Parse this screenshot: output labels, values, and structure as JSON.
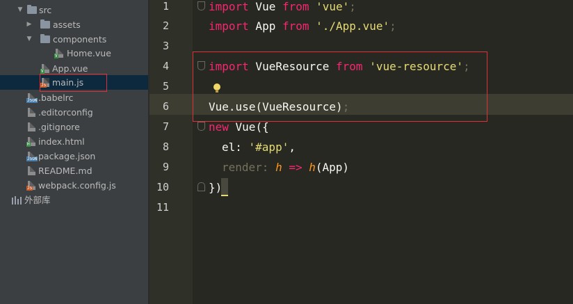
{
  "project_tree": {
    "items": [
      {
        "label": "src",
        "kind": "folder",
        "expanded": true
      },
      {
        "label": "assets",
        "kind": "folder",
        "expanded": false
      },
      {
        "label": "components",
        "kind": "folder",
        "expanded": true
      },
      {
        "label": "Home.vue",
        "kind": "vue-file",
        "badge": "V"
      },
      {
        "label": "App.vue",
        "kind": "vue-file",
        "badge": "V"
      },
      {
        "label": "main.js",
        "kind": "js-file",
        "badge": "JS",
        "selected": true
      },
      {
        "label": ".babelrc",
        "kind": "json-file",
        "badge": "JSON"
      },
      {
        "label": ".editorconfig",
        "kind": "text-file"
      },
      {
        "label": ".gitignore",
        "kind": "text-file"
      },
      {
        "label": "index.html",
        "kind": "html-file",
        "badge": "H"
      },
      {
        "label": "package.json",
        "kind": "json-file",
        "badge": "JSON"
      },
      {
        "label": "README.md",
        "kind": "text-file"
      },
      {
        "label": "webpack.config.js",
        "kind": "js-file",
        "badge": "JS"
      },
      {
        "label": "外部库",
        "kind": "external-libraries"
      }
    ]
  },
  "editor": {
    "line_numbers": [
      "1",
      "2",
      "3",
      "4",
      "5",
      "6",
      "7",
      "8",
      "9",
      "10",
      "11"
    ],
    "lines": {
      "l1": {
        "kw": "import",
        "id": " Vue ",
        "kw2": "from",
        "str": " 'vue'",
        "end": ";"
      },
      "l2": {
        "kw": "import",
        "id": " App ",
        "kw2": "from",
        "str": " './App.vue'",
        "end": ";"
      },
      "l4": {
        "kw": "import",
        "id": " VueResource ",
        "kw2": "from",
        "str": " 'vue-resource'",
        "end": ";"
      },
      "l6": {
        "obj": "Vue",
        "dot": ".",
        "method": "use",
        "args": "(VueResource)",
        "end": ";"
      },
      "l7": {
        "kw": "new",
        "id": " Vue({"
      },
      "l8": {
        "key": "el",
        "colon": ": ",
        "str": "'#app'",
        "comma": ","
      },
      "l9": {
        "key": "render",
        "colon": ": ",
        "param": "h",
        "arrow": " => ",
        "fn": "h",
        "args": "(App)"
      },
      "l10": {
        "close": "})"
      }
    }
  },
  "colors": {
    "background": "#272822",
    "gutter": "#2f3129",
    "sidebar": "#3c3f41",
    "keyword": "#f92672",
    "string": "#e6db74",
    "annotation_box": "#e0303a"
  }
}
